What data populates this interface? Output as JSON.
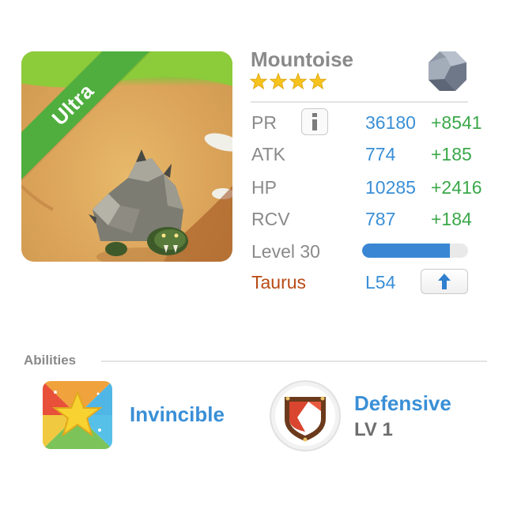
{
  "monster": {
    "name": "Mountoise",
    "star_count": 4,
    "rarity": "Ultra",
    "zodiac_symbol": "♉",
    "element_icon": "stone-element-icon",
    "colors": {
      "rarity_ribbon": "#4fae3e",
      "zodiac_corner": "#c6501a",
      "value_blue": "#3a8fd6",
      "bonus_green": "#3aa84a",
      "zodiac_text": "#b84a14"
    }
  },
  "stats": {
    "pr": {
      "label": "PR",
      "value": "36180",
      "bonus": "+8541"
    },
    "atk": {
      "label": "ATK",
      "value": "774",
      "bonus": "+185"
    },
    "hp": {
      "label": "HP",
      "value": "10285",
      "bonus": "+2416"
    },
    "rcv": {
      "label": "RCV",
      "value": "787",
      "bonus": "+184"
    }
  },
  "level": {
    "label": "Level 30",
    "progress": 0.83
  },
  "zodiac": {
    "label": "Taurus",
    "level": "L54"
  },
  "abilities": {
    "title": "Abilities",
    "items": [
      {
        "name": "Invincible",
        "icon": "star-ability-icon"
      },
      {
        "name": "Defensive",
        "level": "LV 1",
        "icon": "shield-ability-icon"
      }
    ]
  }
}
